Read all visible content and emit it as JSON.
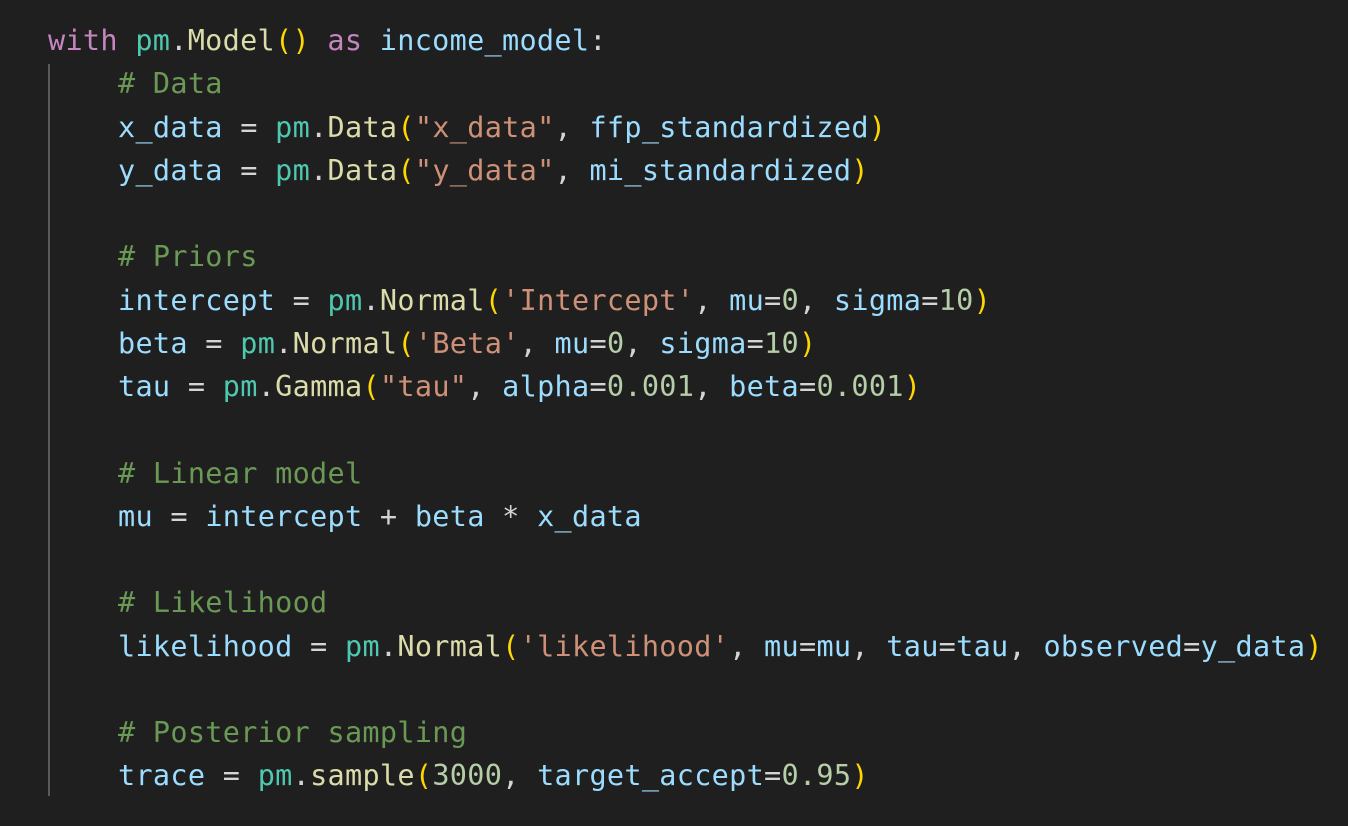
{
  "colors": {
    "background": "#1f1f1f",
    "keyword": "#c586c0",
    "module": "#4ec9b0",
    "function": "#dcdcaa",
    "variable": "#9cdcfe",
    "string": "#ce9178",
    "number": "#b5cea8",
    "comment": "#6a9955",
    "punctuation": "#d4d4d4",
    "bracket_level1": "#ffd700",
    "bracket_level2": "#da70d6"
  },
  "code_lines": [
    {
      "indent": 0,
      "tokens": [
        {
          "t": "with",
          "k": "kw"
        },
        {
          "t": " ",
          "k": "pn"
        },
        {
          "t": "pm",
          "k": "mod"
        },
        {
          "t": ".",
          "k": "pn"
        },
        {
          "t": "Model",
          "k": "fn"
        },
        {
          "t": "()",
          "k": "br1"
        },
        {
          "t": " ",
          "k": "pn"
        },
        {
          "t": "as",
          "k": "kw"
        },
        {
          "t": " ",
          "k": "pn"
        },
        {
          "t": "income_model",
          "k": "var"
        },
        {
          "t": ":",
          "k": "pn"
        }
      ]
    },
    {
      "indent": 1,
      "tokens": [
        {
          "t": "# Data",
          "k": "cmt"
        }
      ]
    },
    {
      "indent": 1,
      "tokens": [
        {
          "t": "x_data",
          "k": "var"
        },
        {
          "t": " = ",
          "k": "pn"
        },
        {
          "t": "pm",
          "k": "mod"
        },
        {
          "t": ".",
          "k": "pn"
        },
        {
          "t": "Data",
          "k": "fn"
        },
        {
          "t": "(",
          "k": "br1"
        },
        {
          "t": "\"x_data\"",
          "k": "str"
        },
        {
          "t": ", ",
          "k": "pn"
        },
        {
          "t": "ffp_standardized",
          "k": "var"
        },
        {
          "t": ")",
          "k": "br1"
        }
      ]
    },
    {
      "indent": 1,
      "tokens": [
        {
          "t": "y_data",
          "k": "var"
        },
        {
          "t": " = ",
          "k": "pn"
        },
        {
          "t": "pm",
          "k": "mod"
        },
        {
          "t": ".",
          "k": "pn"
        },
        {
          "t": "Data",
          "k": "fn"
        },
        {
          "t": "(",
          "k": "br1"
        },
        {
          "t": "\"y_data\"",
          "k": "str"
        },
        {
          "t": ", ",
          "k": "pn"
        },
        {
          "t": "mi_standardized",
          "k": "var"
        },
        {
          "t": ")",
          "k": "br1"
        }
      ]
    },
    {
      "indent": 0,
      "tokens": []
    },
    {
      "indent": 1,
      "tokens": [
        {
          "t": "# Priors",
          "k": "cmt"
        }
      ]
    },
    {
      "indent": 1,
      "tokens": [
        {
          "t": "intercept",
          "k": "var"
        },
        {
          "t": " = ",
          "k": "pn"
        },
        {
          "t": "pm",
          "k": "mod"
        },
        {
          "t": ".",
          "k": "pn"
        },
        {
          "t": "Normal",
          "k": "fn"
        },
        {
          "t": "(",
          "k": "br1"
        },
        {
          "t": "'Intercept'",
          "k": "str"
        },
        {
          "t": ", ",
          "k": "pn"
        },
        {
          "t": "mu",
          "k": "var"
        },
        {
          "t": "=",
          "k": "pn"
        },
        {
          "t": "0",
          "k": "num"
        },
        {
          "t": ", ",
          "k": "pn"
        },
        {
          "t": "sigma",
          "k": "var"
        },
        {
          "t": "=",
          "k": "pn"
        },
        {
          "t": "10",
          "k": "num"
        },
        {
          "t": ")",
          "k": "br1"
        }
      ]
    },
    {
      "indent": 1,
      "tokens": [
        {
          "t": "beta",
          "k": "var"
        },
        {
          "t": " = ",
          "k": "pn"
        },
        {
          "t": "pm",
          "k": "mod"
        },
        {
          "t": ".",
          "k": "pn"
        },
        {
          "t": "Normal",
          "k": "fn"
        },
        {
          "t": "(",
          "k": "br1"
        },
        {
          "t": "'Beta'",
          "k": "str"
        },
        {
          "t": ", ",
          "k": "pn"
        },
        {
          "t": "mu",
          "k": "var"
        },
        {
          "t": "=",
          "k": "pn"
        },
        {
          "t": "0",
          "k": "num"
        },
        {
          "t": ", ",
          "k": "pn"
        },
        {
          "t": "sigma",
          "k": "var"
        },
        {
          "t": "=",
          "k": "pn"
        },
        {
          "t": "10",
          "k": "num"
        },
        {
          "t": ")",
          "k": "br1"
        }
      ]
    },
    {
      "indent": 1,
      "tokens": [
        {
          "t": "tau",
          "k": "var"
        },
        {
          "t": " = ",
          "k": "pn"
        },
        {
          "t": "pm",
          "k": "mod"
        },
        {
          "t": ".",
          "k": "pn"
        },
        {
          "t": "Gamma",
          "k": "fn"
        },
        {
          "t": "(",
          "k": "br1"
        },
        {
          "t": "\"tau\"",
          "k": "str"
        },
        {
          "t": ", ",
          "k": "pn"
        },
        {
          "t": "alpha",
          "k": "var"
        },
        {
          "t": "=",
          "k": "pn"
        },
        {
          "t": "0.001",
          "k": "num"
        },
        {
          "t": ", ",
          "k": "pn"
        },
        {
          "t": "beta",
          "k": "var"
        },
        {
          "t": "=",
          "k": "pn"
        },
        {
          "t": "0.001",
          "k": "num"
        },
        {
          "t": ")",
          "k": "br1"
        }
      ]
    },
    {
      "indent": 0,
      "tokens": []
    },
    {
      "indent": 1,
      "tokens": [
        {
          "t": "# Linear model",
          "k": "cmt"
        }
      ]
    },
    {
      "indent": 1,
      "tokens": [
        {
          "t": "mu",
          "k": "var"
        },
        {
          "t": " = ",
          "k": "pn"
        },
        {
          "t": "intercept",
          "k": "var"
        },
        {
          "t": " + ",
          "k": "pn"
        },
        {
          "t": "beta",
          "k": "var"
        },
        {
          "t": " * ",
          "k": "pn"
        },
        {
          "t": "x_data",
          "k": "var"
        }
      ]
    },
    {
      "indent": 0,
      "tokens": []
    },
    {
      "indent": 1,
      "tokens": [
        {
          "t": "# Likelihood",
          "k": "cmt"
        }
      ]
    },
    {
      "indent": 1,
      "tokens": [
        {
          "t": "likelihood",
          "k": "var"
        },
        {
          "t": " = ",
          "k": "pn"
        },
        {
          "t": "pm",
          "k": "mod"
        },
        {
          "t": ".",
          "k": "pn"
        },
        {
          "t": "Normal",
          "k": "fn"
        },
        {
          "t": "(",
          "k": "br1"
        },
        {
          "t": "'likelihood'",
          "k": "str"
        },
        {
          "t": ", ",
          "k": "pn"
        },
        {
          "t": "mu",
          "k": "var"
        },
        {
          "t": "=",
          "k": "pn"
        },
        {
          "t": "mu",
          "k": "var"
        },
        {
          "t": ", ",
          "k": "pn"
        },
        {
          "t": "tau",
          "k": "var"
        },
        {
          "t": "=",
          "k": "pn"
        },
        {
          "t": "tau",
          "k": "var"
        },
        {
          "t": ", ",
          "k": "pn"
        },
        {
          "t": "observed",
          "k": "var"
        },
        {
          "t": "=",
          "k": "pn"
        },
        {
          "t": "y_data",
          "k": "var"
        },
        {
          "t": ")",
          "k": "br1"
        }
      ]
    },
    {
      "indent": 0,
      "tokens": []
    },
    {
      "indent": 1,
      "tokens": [
        {
          "t": "# Posterior sampling",
          "k": "cmt"
        }
      ]
    },
    {
      "indent": 1,
      "tokens": [
        {
          "t": "trace",
          "k": "var"
        },
        {
          "t": " = ",
          "k": "pn"
        },
        {
          "t": "pm",
          "k": "mod"
        },
        {
          "t": ".",
          "k": "pn"
        },
        {
          "t": "sample",
          "k": "fn"
        },
        {
          "t": "(",
          "k": "br1"
        },
        {
          "t": "3000",
          "k": "num"
        },
        {
          "t": ", ",
          "k": "pn"
        },
        {
          "t": "target_accept",
          "k": "var"
        },
        {
          "t": "=",
          "k": "pn"
        },
        {
          "t": "0.95",
          "k": "num"
        },
        {
          "t": ")",
          "k": "br1"
        }
      ]
    }
  ]
}
